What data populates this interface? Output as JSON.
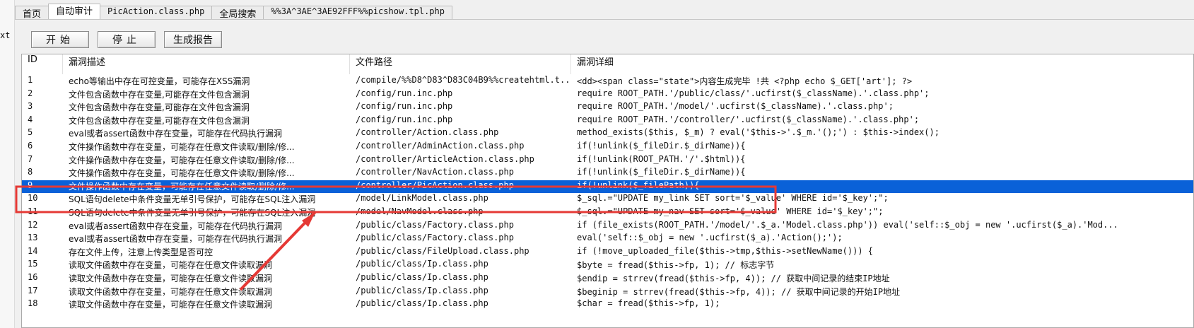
{
  "left_clip_text": "xt",
  "tabs": [
    {
      "label": "首页",
      "active": false
    },
    {
      "label": "自动审计",
      "active": true
    },
    {
      "label": "PicAction.class.php",
      "active": false
    },
    {
      "label": "全局搜索",
      "active": false
    },
    {
      "label": "%%3A^3AE^3AE92FFF%%picshow.tpl.php",
      "active": false
    }
  ],
  "toolbar": {
    "start_label": "开始",
    "stop_label": "停止",
    "report_label": "生成报告"
  },
  "table": {
    "headers": {
      "id": "ID",
      "desc": "漏洞描述",
      "path": "文件路径",
      "detail": "漏洞详细"
    },
    "rows": [
      {
        "id": "1",
        "desc": "echo等输出中存在可控变量，可能存在XSS漏洞",
        "path": "/compile/%%D8^D83^D83C04B9%%createhtml.t...",
        "detail": "<dd><span class=\"state\">内容生成完毕 !共 <?php echo $_GET['art']; ?>"
      },
      {
        "id": "2",
        "desc": "文件包含函数中存在变量,可能存在文件包含漏洞",
        "path": "/config/run.inc.php",
        "detail": "require ROOT_PATH.'/public/class/'.ucfirst($_className).'.class.php';"
      },
      {
        "id": "3",
        "desc": "文件包含函数中存在变量,可能存在文件包含漏洞",
        "path": "/config/run.inc.php",
        "detail": "require ROOT_PATH.'/model/'.ucfirst($_className).'.class.php';"
      },
      {
        "id": "4",
        "desc": "文件包含函数中存在变量,可能存在文件包含漏洞",
        "path": "/config/run.inc.php",
        "detail": "require ROOT_PATH.'/controller/'.ucfirst($_className).'.class.php';"
      },
      {
        "id": "5",
        "desc": "eval或者assert函数中存在变量，可能存在代码执行漏洞",
        "path": "/controller/Action.class.php",
        "detail": "method_exists($this, $_m) ? eval('$this->'.$_m.'();') : $this->index();"
      },
      {
        "id": "6",
        "desc": "文件操作函数中存在变量，可能存在任意文件读取/删除/修...",
        "path": "/controller/AdminAction.class.php",
        "detail": "if(!unlink($_fileDir.$_dirName)){"
      },
      {
        "id": "7",
        "desc": "文件操作函数中存在变量，可能存在任意文件读取/删除/修...",
        "path": "/controller/ArticleAction.class.php",
        "detail": "if(!unlink(ROOT_PATH.'/'.$html)){"
      },
      {
        "id": "8",
        "desc": "文件操作函数中存在变量，可能存在任意文件读取/删除/修...",
        "path": "/controller/NavAction.class.php",
        "detail": "if(!unlink($_fileDir.$_dirName)){"
      },
      {
        "id": "9",
        "desc": "文件操作函数中存在变量，可能存在任意文件读取/删除/修...",
        "path": "/controller/PicAction.class.php",
        "detail": "if(!unlink($_filePath)){"
      },
      {
        "id": "10",
        "desc": "SQL语句delete中条件变量无单引号保护，可能存在SQL注入漏洞",
        "path": "/model/LinkModel.class.php",
        "detail": "$_sql.=\"UPDATE my_link SET sort='$_value' WHERE id='$_key';\";"
      },
      {
        "id": "11",
        "desc": "SQL语句delete中条件变量无单引号保护，可能存在SQL注入漏洞",
        "path": "/model/NavModel.class.php",
        "detail": "$_sql.=\"UPDATE my_nav SET sort='$_value' WHERE id='$_key';\";"
      },
      {
        "id": "12",
        "desc": "eval或者assert函数中存在变量，可能存在代码执行漏洞",
        "path": "/public/class/Factory.class.php",
        "detail": "if (file_exists(ROOT_PATH.'/model/'.$_a.'Model.class.php')) eval('self::$_obj = new '.ucfirst($_a).'Mod..."
      },
      {
        "id": "13",
        "desc": "eval或者assert函数中存在变量，可能存在代码执行漏洞",
        "path": "/public/class/Factory.class.php",
        "detail": "eval('self::$_obj = new '.ucfirst($_a).'Action();');"
      },
      {
        "id": "14",
        "desc": "存在文件上传，注意上传类型是否可控",
        "path": "/public/class/FileUpload.class.php",
        "detail": "if (!move_uploaded_file($this->tmp,$this->setNewName())) {"
      },
      {
        "id": "15",
        "desc": "读取文件函数中存在变量，可能存在任意文件读取漏洞",
        "path": "/public/class/Ip.class.php",
        "detail": "$byte = fread($this->fp, 1); // 标志字节"
      },
      {
        "id": "16",
        "desc": "读取文件函数中存在变量，可能存在任意文件读取漏洞",
        "path": "/public/class/Ip.class.php",
        "detail": "$endip = strrev(fread($this->fp, 4)); // 获取中间记录的结束IP地址"
      },
      {
        "id": "17",
        "desc": "读取文件函数中存在变量，可能存在任意文件读取漏洞",
        "path": "/public/class/Ip.class.php",
        "detail": "$beginip = strrev(fread($this->fp, 4)); // 获取中间记录的开始IP地址"
      },
      {
        "id": "18",
        "desc": "读取文件函数中存在变量，可能存在任意文件读取漏洞",
        "path": "/public/class/Ip.class.php",
        "detail": "$char = fread($this->fp, 1);"
      }
    ],
    "selected_row_index": 8
  },
  "colors": {
    "selection": "#0a61d8",
    "annotation": "#e53935"
  }
}
